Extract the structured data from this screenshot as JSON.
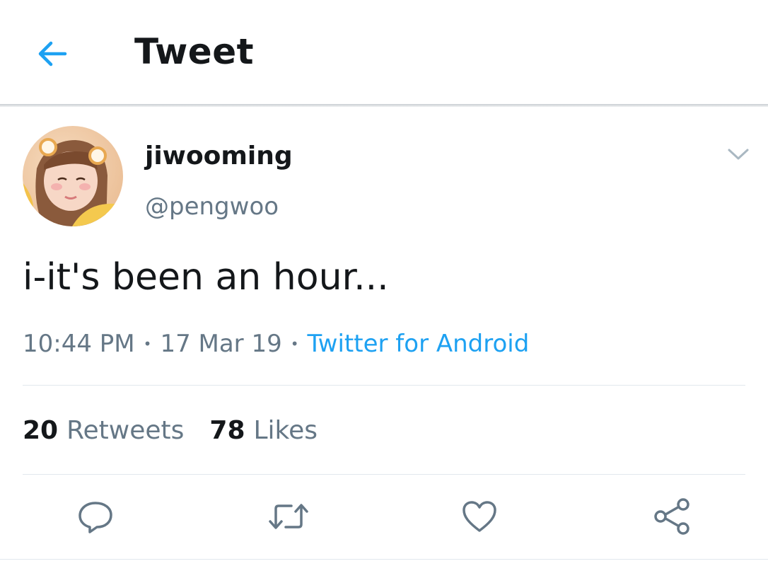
{
  "header": {
    "title": "Tweet",
    "back_icon": "back-arrow-icon",
    "accent_color": "#1da1f2"
  },
  "tweet": {
    "display_name": "jiwooming",
    "handle": "@pengwoo",
    "text": "i-it's been an hour...",
    "time": "10:44 PM",
    "separator": "•",
    "date": "17 Mar 19",
    "source": "Twitter for Android",
    "avatar_icon": "profile-photo",
    "menu_icon": "chevron-down-icon"
  },
  "stats": {
    "retweets_count": "20",
    "retweets_label": "Retweets",
    "likes_count": "78",
    "likes_label": "Likes"
  },
  "actions": {
    "reply_icon": "reply-icon",
    "retweet_icon": "retweet-icon",
    "like_icon": "heart-icon",
    "share_icon": "share-icon"
  },
  "colors": {
    "primary_text": "#14171a",
    "secondary_text": "#657786",
    "link": "#1da1f2",
    "divider": "#e1e8ed"
  }
}
